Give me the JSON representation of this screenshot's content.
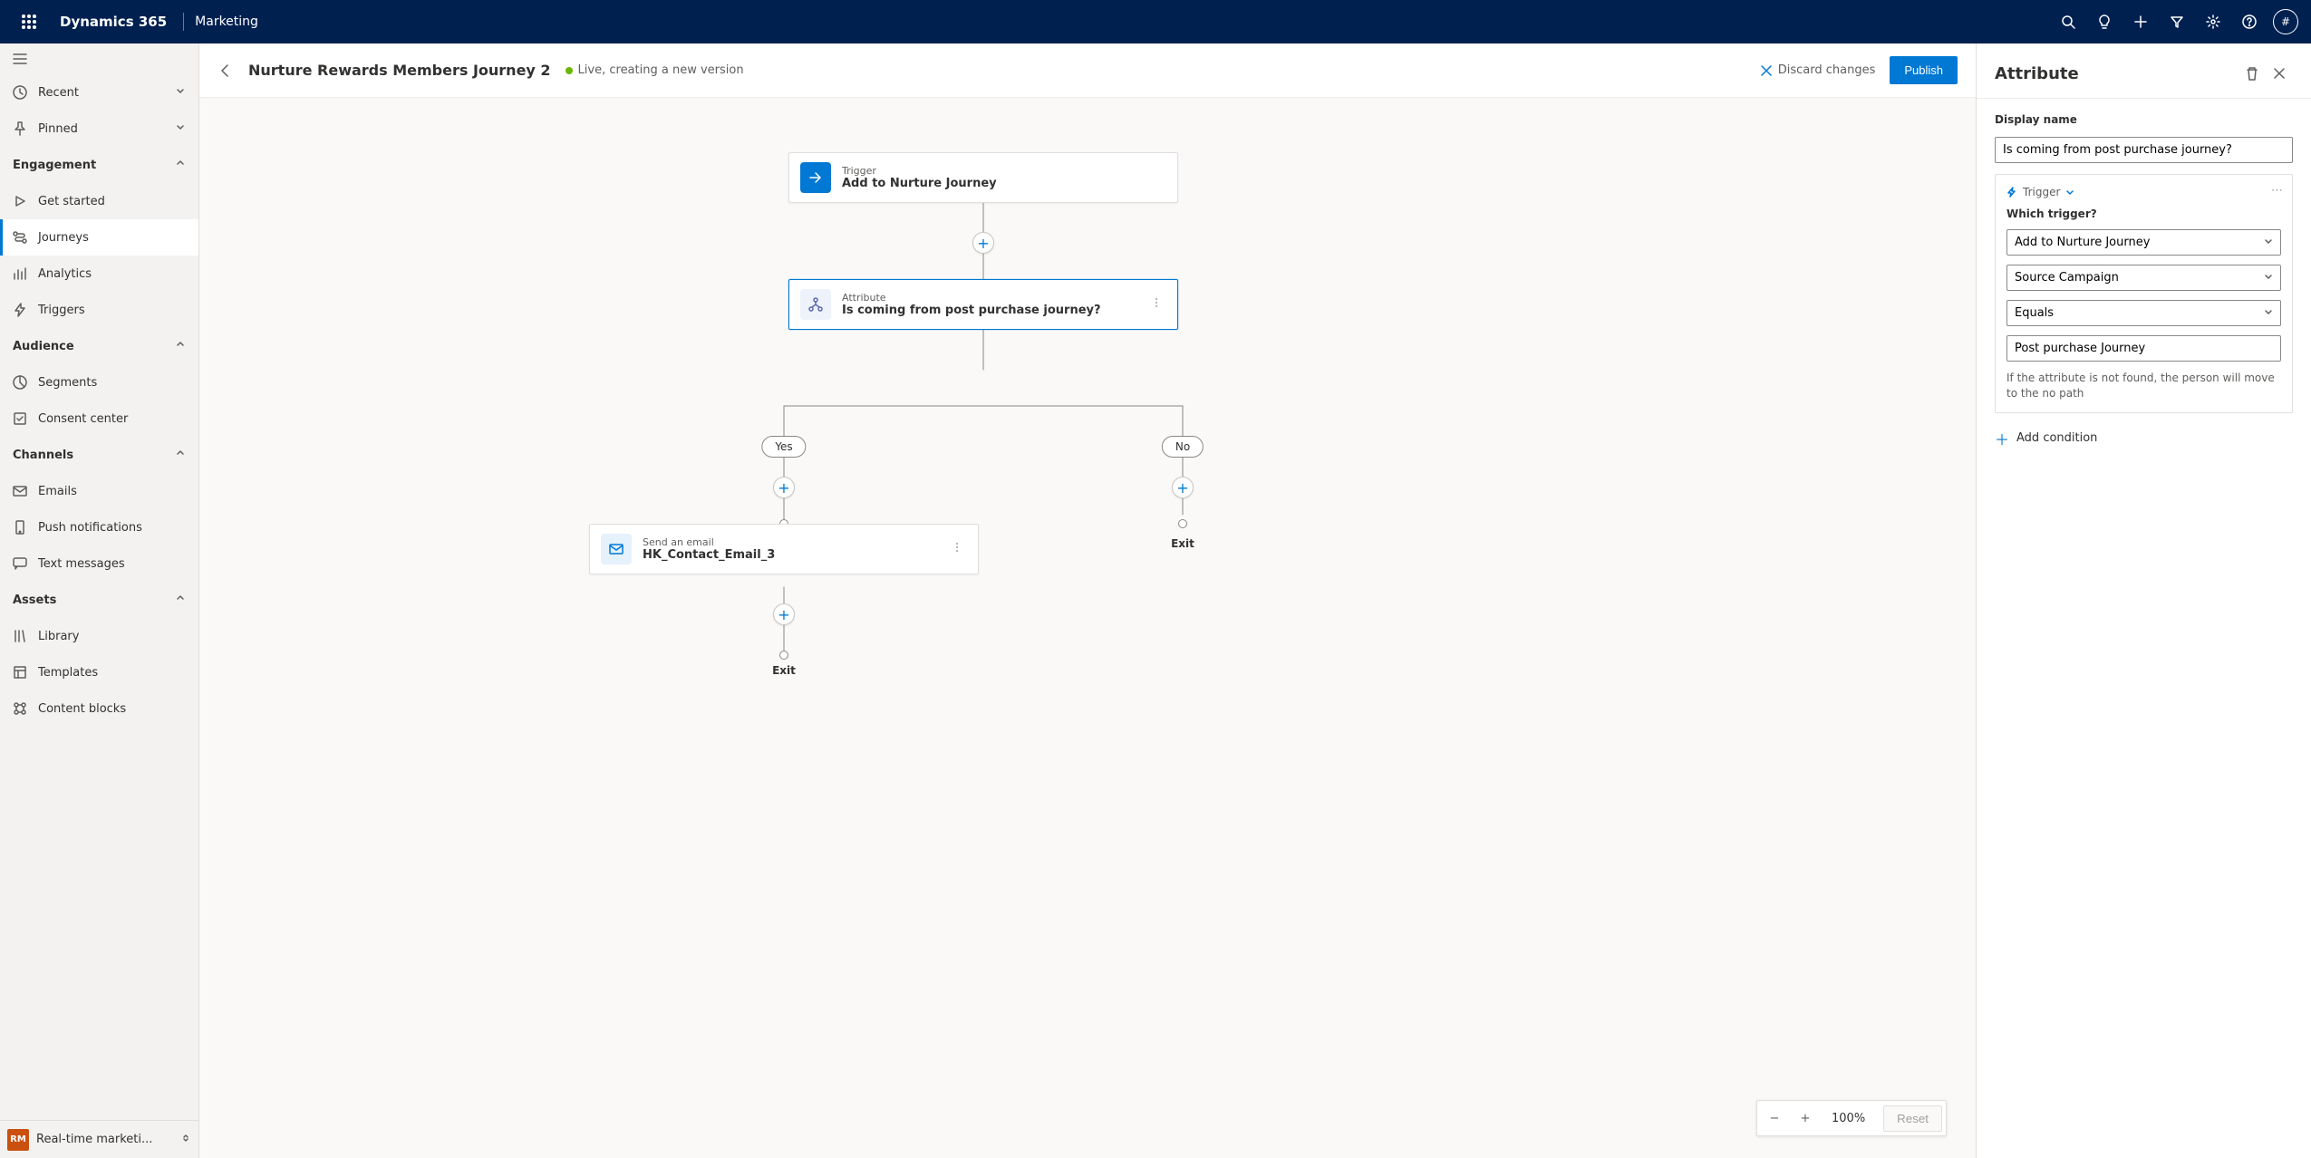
{
  "topbar": {
    "brand": "Dynamics 365",
    "module": "Marketing",
    "avatar": "#"
  },
  "sidebar": {
    "recent": "Recent",
    "pinned": "Pinned",
    "sections": {
      "engagement": "Engagement",
      "audience": "Audience",
      "channels": "Channels",
      "assets": "Assets"
    },
    "items": {
      "get_started": "Get started",
      "journeys": "Journeys",
      "analytics": "Analytics",
      "triggers": "Triggers",
      "segments": "Segments",
      "consent": "Consent center",
      "emails": "Emails",
      "push": "Push notifications",
      "text": "Text messages",
      "library": "Library",
      "templates": "Templates",
      "blocks": "Content blocks"
    },
    "footer": {
      "badge": "RM",
      "label": "Real-time marketi..."
    }
  },
  "page": {
    "title": "Nurture Rewards Members Journey 2",
    "status": "Live, creating a new version",
    "discard": "Discard changes",
    "publish": "Publish"
  },
  "nodes": {
    "trigger": {
      "type": "Trigger",
      "name": "Add to Nurture Journey"
    },
    "attr": {
      "type": "Attribute",
      "name": "Is coming from post purchase journey?"
    },
    "email": {
      "type": "Send an email",
      "name": "HK_Contact_Email_3"
    },
    "yes": "Yes",
    "no": "No",
    "exit": "Exit"
  },
  "zoom": {
    "value": "100%",
    "reset": "Reset"
  },
  "panel": {
    "title": "Attribute",
    "display_name_label": "Display name",
    "display_name_value": "Is coming from post purchase journey?",
    "trigger_heading": "Trigger",
    "which_trigger_label": "Which trigger?",
    "which_trigger_value": "Add to Nurture Journey",
    "field_value": "Source Campaign",
    "operator_value": "Equals",
    "compare_value": "Post purchase Journey",
    "hint": "If the attribute is not found, the person will move to the no path",
    "add_condition": "Add condition"
  }
}
